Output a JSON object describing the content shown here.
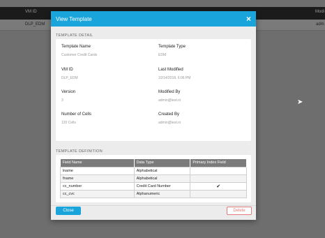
{
  "background": {
    "header": {
      "col1": "VM ID",
      "col2": "Modi"
    },
    "row": {
      "col1": "DLP_EDM",
      "col2": "adm"
    }
  },
  "modal": {
    "title": "View Template",
    "close_icon": "×",
    "detail_section_label": "TEMPLATE DETAIL",
    "details": {
      "template_name": {
        "label": "Template Name",
        "value": "Customer Credit Cards"
      },
      "template_type": {
        "label": "Template Type",
        "value": "EDM"
      },
      "vm_id": {
        "label": "VM ID",
        "value": "DLP_EDM"
      },
      "last_modified": {
        "label": "Last Modified",
        "value": "10/14/2018, 6:06 PM"
      },
      "version": {
        "label": "Version",
        "value": "3"
      },
      "modified_by": {
        "label": "Modified By",
        "value": "admin@test.ni"
      },
      "number_of_cells": {
        "label": "Number of Cells",
        "value": "120 Cells"
      },
      "created_by": {
        "label": "Created By",
        "value": "admin@test.ni"
      }
    },
    "definition_section_label": "TEMPLATE DEFINITION",
    "table": {
      "headers": [
        "Field Name",
        "Data Type",
        "Primary Index Field"
      ],
      "rows": [
        {
          "field": "lname",
          "type": "Alphabetical",
          "primary": ""
        },
        {
          "field": "fname",
          "type": "Alphabetical",
          "primary": ""
        },
        {
          "field": "cc_number",
          "type": "Credit Card Number",
          "primary": "✔"
        },
        {
          "field": "cc_cvc",
          "type": "Alphanumeric",
          "primary": ""
        }
      ]
    },
    "close_button": "Close",
    "delete_button": "Delete"
  },
  "colors": {
    "accent": "#1aa4dc",
    "danger": "#e07b7b"
  }
}
